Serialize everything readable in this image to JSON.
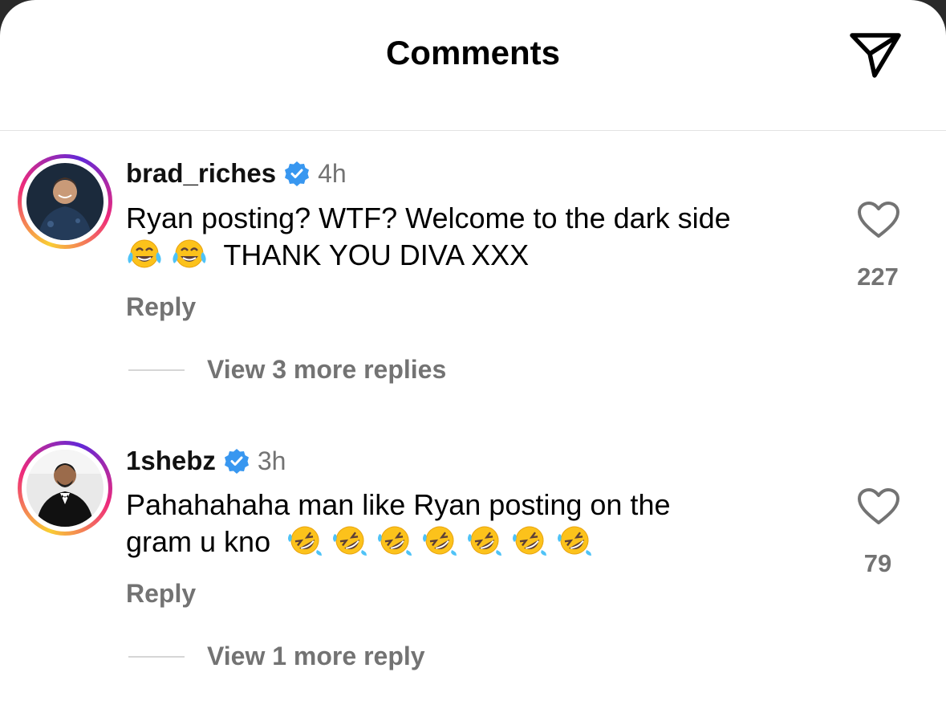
{
  "header": {
    "title": "Comments",
    "share_icon": "send-icon"
  },
  "colors": {
    "text_primary": "#000000",
    "text_secondary": "#737373",
    "verified_blue": "#3897f0",
    "ring_gradient": [
      "#f9ce34",
      "#ee2a7b",
      "#6228d7"
    ]
  },
  "comments": [
    {
      "username": "brad_riches",
      "verified": true,
      "time": "4h",
      "text_line1": "Ryan posting? WTF? Welcome to the dark side",
      "text_line2": "THANK YOU DIVA XXX",
      "emojis": [
        "face-with-tears-of-joy",
        "face-with-tears-of-joy"
      ],
      "likes": "227",
      "reply_label": "Reply",
      "more_replies": "View 3 more replies"
    },
    {
      "username": "1shebz",
      "verified": true,
      "time": "3h",
      "text_line1": "Pahahahaha man like Ryan posting on the",
      "text_line2": "gram u kno",
      "emojis": [
        "rolling-on-the-floor-laughing",
        "rolling-on-the-floor-laughing",
        "rolling-on-the-floor-laughing",
        "rolling-on-the-floor-laughing",
        "rolling-on-the-floor-laughing",
        "rolling-on-the-floor-laughing",
        "rolling-on-the-floor-laughing"
      ],
      "likes": "79",
      "reply_label": "Reply",
      "more_replies": "View 1 more reply"
    }
  ]
}
